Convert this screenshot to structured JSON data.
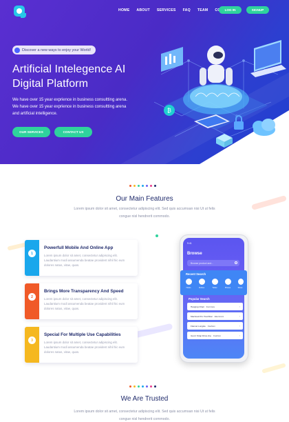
{
  "nav": {
    "items": [
      "HOME",
      "ABOUT",
      "SERVICES",
      "FAQ",
      "TEAM",
      "CONTACT"
    ],
    "login": "LOG IN",
    "signup": "SIGNUP"
  },
  "hero": {
    "pill": "Discover a new ways to enjoy your World!",
    "title_line1": "Artificial Intelegence AI",
    "title_line2": "Digital Platform",
    "text": "We have over 15 year exprience in business consultting arena. We have over 15 year exprience in business consultting arena and artificial intelligence.",
    "cta_primary": "OUR SERVICES",
    "cta_secondary": "CONTACT US"
  },
  "features": {
    "title": "Our Main Features",
    "subtitle": "Lorem ipsum dolor sit amet, consectetur adipiscing elit. Sed quis accumsan nisi Ut ut felis congue nisl hendrerit commodo.",
    "items": [
      {
        "num": "1",
        "title": "Powerfull Mobile And Online App",
        "text": "Lorem ipsum dolor sit amet, consectetur adipiscing elit. Laudantium modi assumenda beatae provident nihil hic eum dolores natus, vitae, quas.",
        "color": "#1aa7ec"
      },
      {
        "num": "2",
        "title": "Brings More Transparency And Speed",
        "text": "Lorem ipsum dolor sit amet, consectetur adipiscing elit. Laudantium modi assumenda beatae provident nihil hic eum dolores natus, vitae, quas.",
        "color": "#f05a28"
      },
      {
        "num": "3",
        "title": "Special For Multiple Use Capabilities",
        "text": "Lorem ipsum dolor sit amet, consectetur adipiscing elit. Laudantium modi assumenda beatae provident nihil hic eum dolores natus, vitae, quas.",
        "color": "#f5b820"
      }
    ]
  },
  "phone": {
    "time": "9:41",
    "browse": "Browse",
    "search_placeholder": "Browse product and...",
    "recent_title": "Recent Search",
    "recent": [
      "Hotels",
      "Clothes",
      "Twitter",
      "Phones",
      "Shoes"
    ],
    "popular_title": "Popular Search",
    "popular": [
      {
        "name": "Hanging Chair",
        "cat": "Furniture"
      },
      {
        "name": "Macbook Pro Touchbar",
        "cat": "Electronic"
      },
      {
        "name": "Flannel Longsle",
        "cat": "Fashion"
      },
      {
        "name": "Gucci Strap Drive-line",
        "cat": "Fashion"
      }
    ]
  },
  "trusted": {
    "title": "We Are Trusted",
    "subtitle": "Lorem ipsum dolor sit amet, consectetur adipiscing elit. Sed quis accumsan nisi Ut ut felis congue nisl hendrerit commodo."
  },
  "colors": {
    "accent_green": "#2fd39d",
    "hero_purple": "#4a2bc6",
    "heading_navy": "#1f2a6b",
    "dot_palette": [
      "#f05a28",
      "#f5b820",
      "#2fd39d",
      "#1aa7ec",
      "#6a5ff4",
      "#e83e8c",
      "#1f2a6b"
    ]
  }
}
